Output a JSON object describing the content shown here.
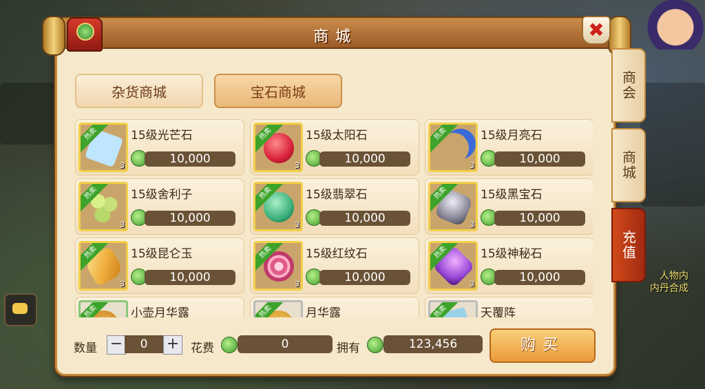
{
  "window": {
    "title": "商城"
  },
  "categories": [
    {
      "label": "杂货商城",
      "active": false
    },
    {
      "label": "宝石商城",
      "active": true
    }
  ],
  "side_tabs": [
    {
      "label": "商会"
    },
    {
      "label": "商城"
    },
    {
      "label": "充值"
    }
  ],
  "hot_label": "热卖",
  "items": [
    {
      "name": "15级光芒石",
      "price": "10,000",
      "qty": "3",
      "color": "#bfe6ff"
    },
    {
      "name": "15级太阳石",
      "price": "10,000",
      "qty": "3",
      "color": "#d8203a"
    },
    {
      "name": "15级月亮石",
      "price": "10,000",
      "qty": "3",
      "color": "#3a6ad8"
    },
    {
      "name": "15级舍利子",
      "price": "10,000",
      "qty": "3",
      "color": "#b8d86a"
    },
    {
      "name": "15级翡翠石",
      "price": "10,000",
      "qty": "3",
      "color": "#3ab07a"
    },
    {
      "name": "15级黑宝石",
      "price": "10,000",
      "qty": "3",
      "color": "#7a7a8a"
    },
    {
      "name": "15级昆仑玉",
      "price": "10,000",
      "qty": "3",
      "color": "#f0b040"
    },
    {
      "name": "15级红纹石",
      "price": "10,000",
      "qty": "3",
      "color": "#e05a8a"
    },
    {
      "name": "15级神秘石",
      "price": "10,000",
      "qty": "3",
      "color": "#9a4ad8"
    },
    {
      "name": "小壶月华露",
      "color": "#d8a040"
    },
    {
      "name": "月华露",
      "color": "#e0b050"
    },
    {
      "name": "天覆阵",
      "color": "#6ab0d8"
    }
  ],
  "bottom": {
    "quantity_label": "数量",
    "minus": "−",
    "plus": "+",
    "quantity_value": "0",
    "cost_label": "花费",
    "cost_value": "0",
    "own_label": "拥有",
    "own_value": "123,456",
    "buy_label": "购买"
  },
  "background": {
    "text_1": "人物内",
    "text_2": "内丹合成"
  }
}
